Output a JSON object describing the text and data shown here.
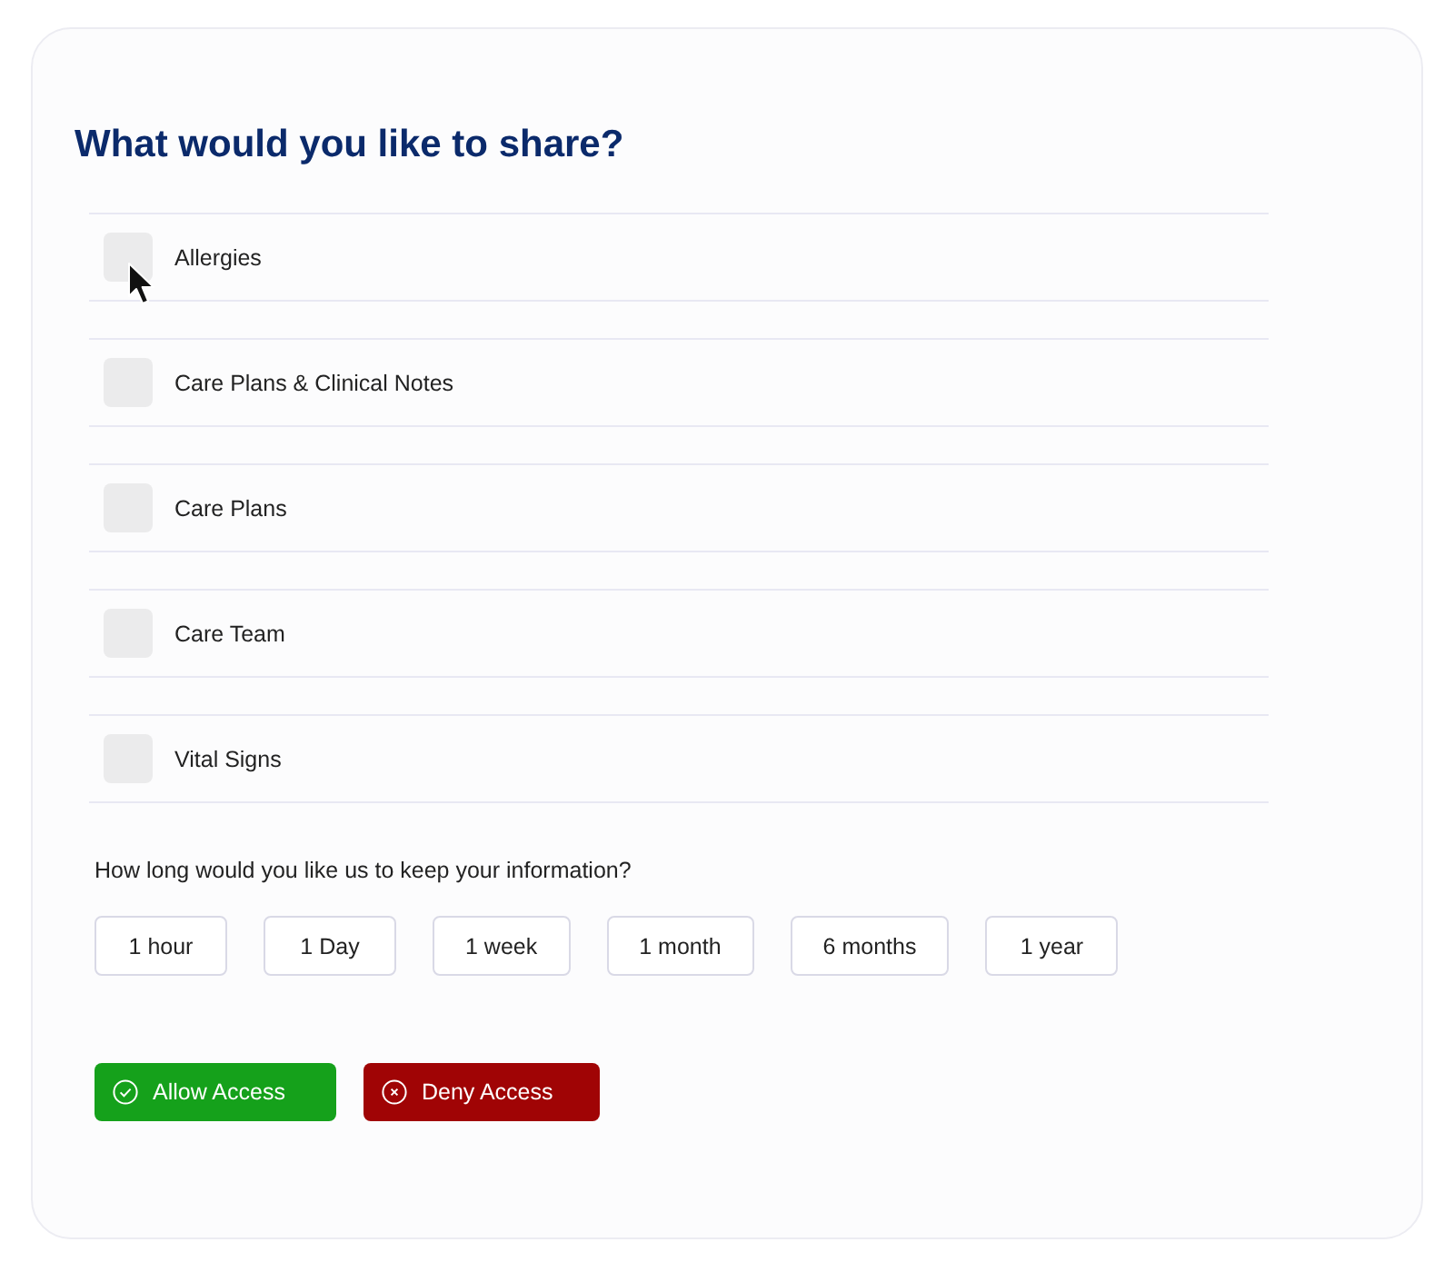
{
  "title": "What would you like to share?",
  "categories": [
    {
      "label": "Allergies",
      "checked": false
    },
    {
      "label": "Care Plans & Clinical Notes",
      "checked": false
    },
    {
      "label": "Care Plans",
      "checked": false
    },
    {
      "label": "Care Team",
      "checked": false
    },
    {
      "label": "Vital Signs",
      "checked": false
    }
  ],
  "retention": {
    "question": "How long would you like us to keep your information?",
    "options": [
      {
        "label": "1 hour",
        "selected": false
      },
      {
        "label": "1 Day",
        "selected": false
      },
      {
        "label": "1 week",
        "selected": false
      },
      {
        "label": "1 month",
        "selected": false
      },
      {
        "label": "6 months",
        "selected": false
      },
      {
        "label": "1 year",
        "selected": false
      }
    ]
  },
  "actions": [
    {
      "kind": "allow",
      "label": "Allow Access"
    },
    {
      "kind": "deny",
      "label": "Deny Access"
    }
  ]
}
